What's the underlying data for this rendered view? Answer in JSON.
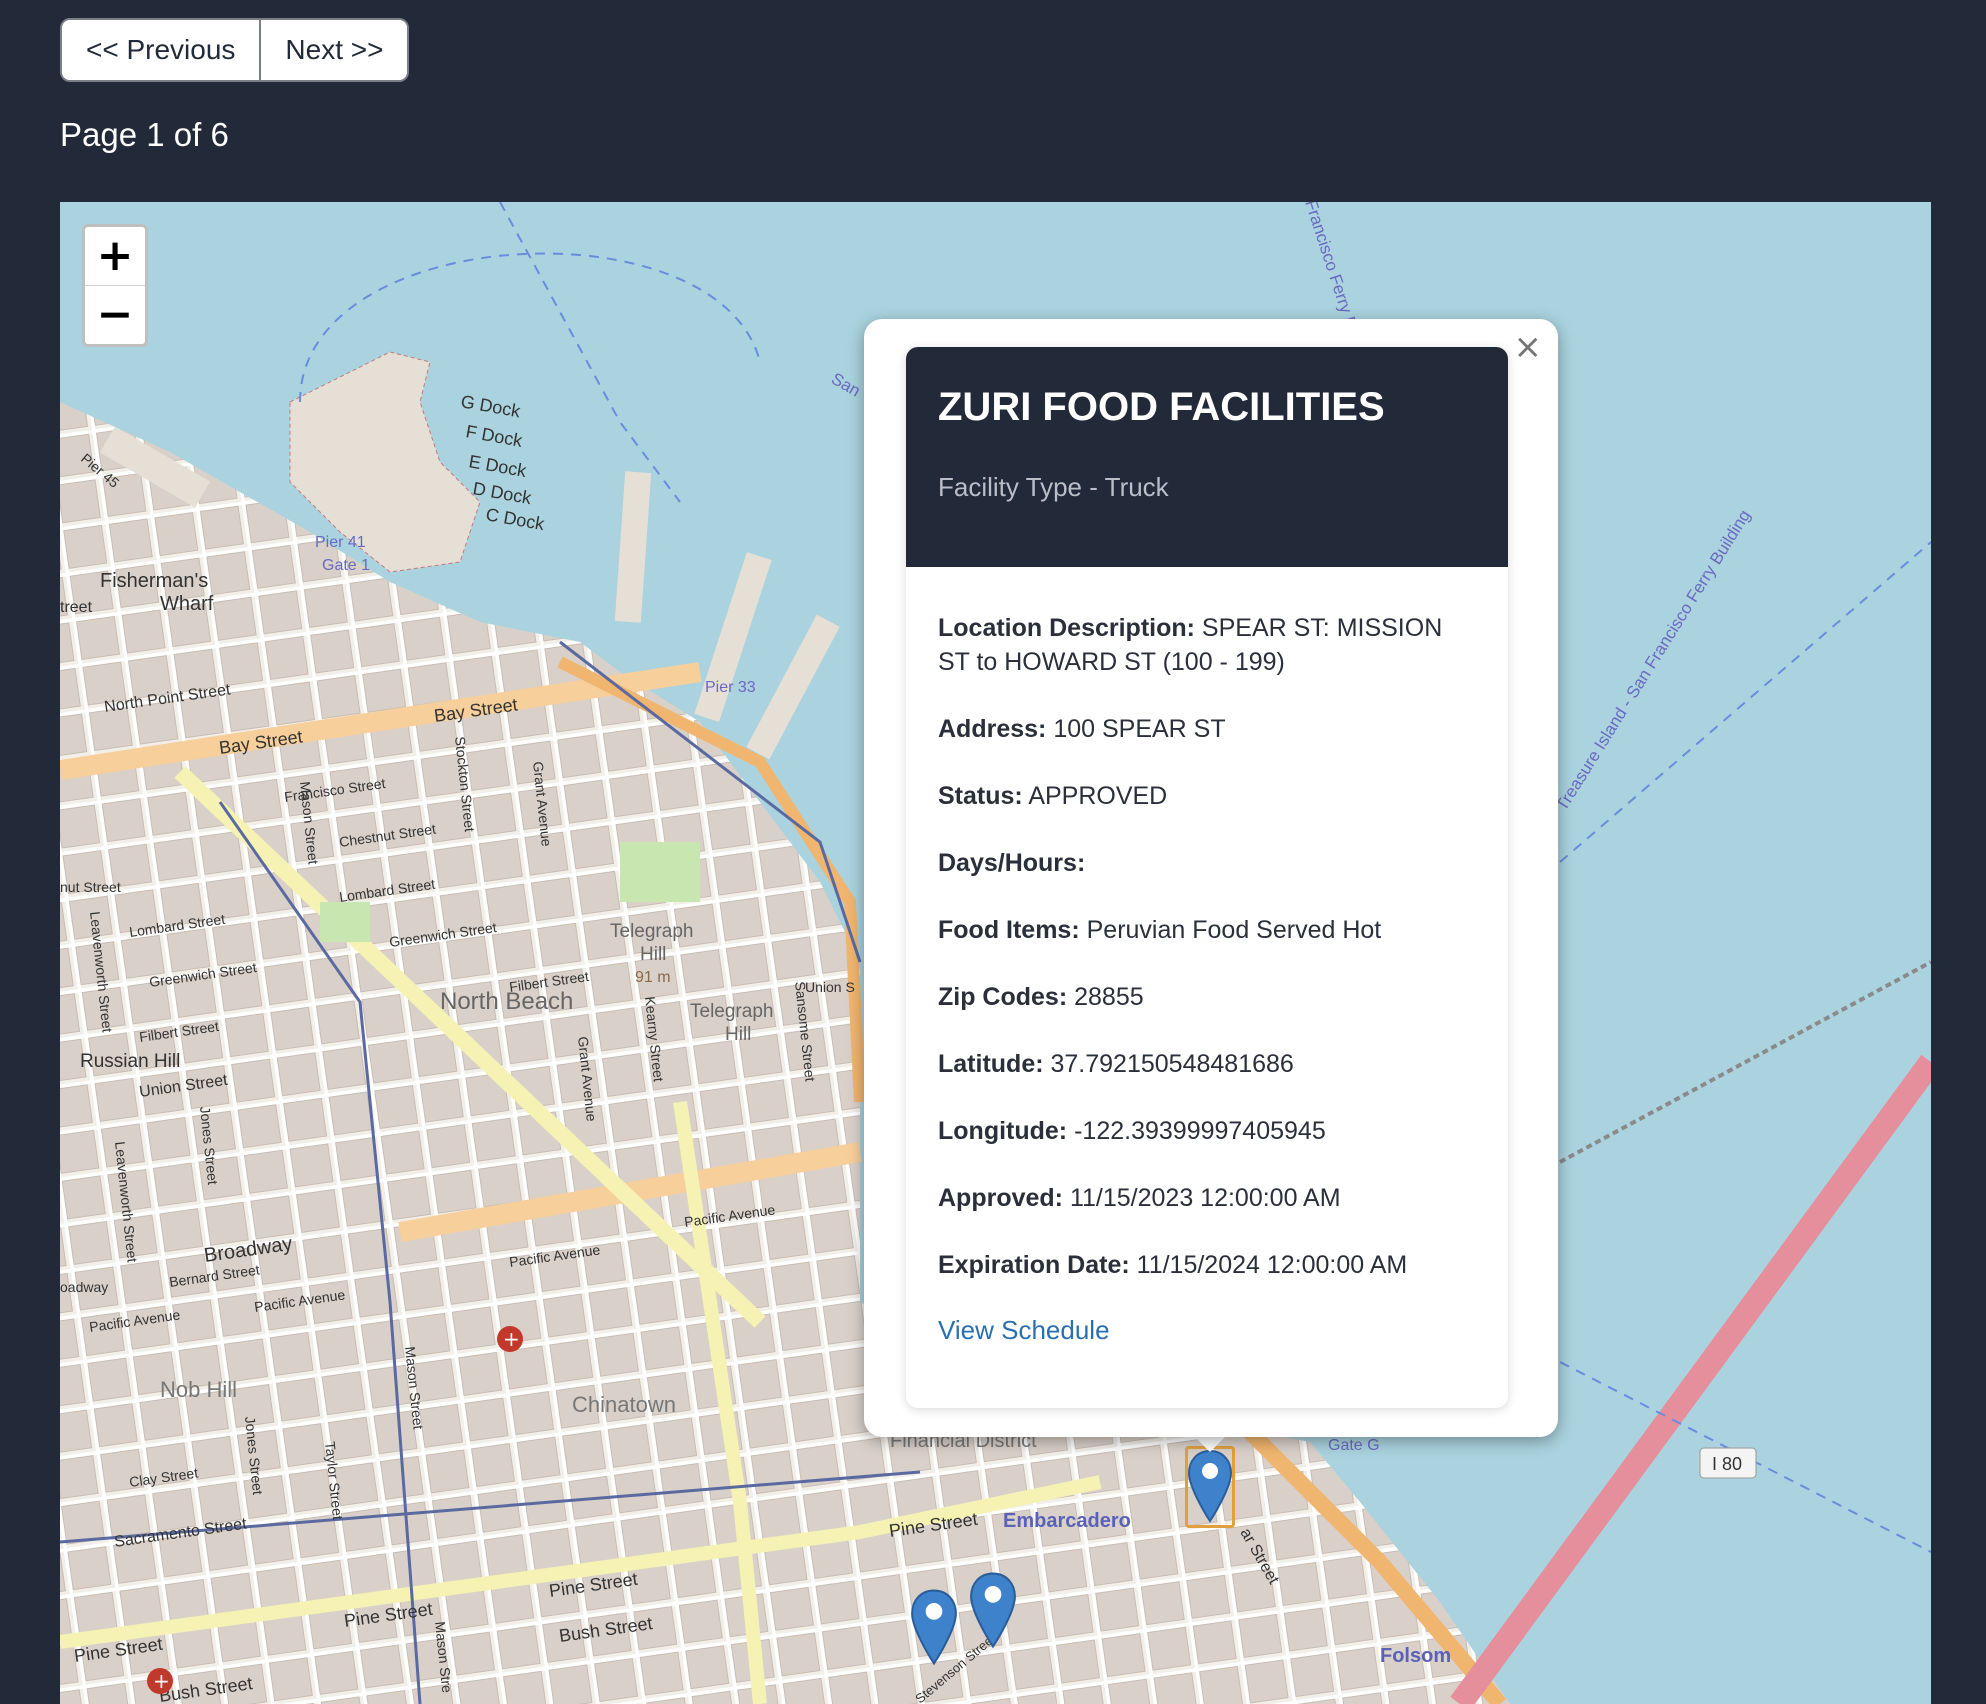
{
  "pager": {
    "prev_label": "<< Previous",
    "next_label": "Next >>",
    "page_text": "Page 1 of 6"
  },
  "map": {
    "zoom_in": "+",
    "zoom_out": "−",
    "labels": {
      "g_dock": "G Dock",
      "f_dock": "F Dock",
      "e_dock": "E Dock",
      "d_dock": "D Dock",
      "c_dock": "C Dock",
      "pier45": "Pier 45",
      "pier41": "Pier 41",
      "gate1": "Gate 1",
      "pier33": "Pier 33",
      "fishermans": "Fisherman's",
      "wharf": "Wharf",
      "north_point": "North Point Street",
      "bay1": "Bay Street",
      "bay2": "Bay Street",
      "francisco": "Francisco Street",
      "chestnut": "Chestnut Street",
      "lombard1": "Lombard Street",
      "lombard2": "Lombard Street",
      "greenwich1": "Greenwich Street",
      "greenwich2": "Greenwich Street",
      "filbert1": "Filbert Street",
      "filbert2": "Filbert Street",
      "union": "Union Street",
      "russian_hill": "Russian Hill",
      "north_beach": "North Beach",
      "telegraph": "Telegraph",
      "hill": "Hill",
      "hill_alt": "91 m",
      "telegraph2": "Telegraph",
      "hill2": "Hill",
      "broadway": "Broadway",
      "bernard": "Bernard Street",
      "pacific1": "Pacific Avenue",
      "pacific2": "Pacific Avenue",
      "pacific3": "Pacific Avenue",
      "pacific4": "Pacific Avenue",
      "nob_hill": "Nob Hill",
      "chinatown": "Chinatown",
      "clay": "Clay Street",
      "sacramento": "Sacramento Street",
      "pine1": "Pine Street",
      "pine2": "Pine Street",
      "pine3": "Pine Street",
      "pine4": "Pine Street",
      "bush1": "Bush Street",
      "bush2": "Bush Street",
      "financial": "Financial District",
      "embarcadero": "Embarcadero",
      "folsom": "Folsom",
      "gate_g": "Gate G",
      "i80": "I 80",
      "treasure": "Treasure Island - San Francisco Ferry Building",
      "ferry": "Francisco Ferry B",
      "san": "San",
      "sansome": "Sansome Street",
      "kearny": "Kearny Street",
      "grant1": "Grant Avenue",
      "grant2": "Grant Avenue",
      "stockton": "Stockton Street",
      "mason1": "Mason Street",
      "mason2": "Mason Street",
      "mason3": "Mason Stre",
      "jones1": "Jones Street",
      "jones2": "Jones Street",
      "taylor": "Taylor Street",
      "leavenworth1": "Leavenworth Street",
      "leavenworth2": "Leavenworth Street",
      "union_s": "Union S",
      "street_w": "treet",
      "nut": "nut Street",
      "oadway": "oadway",
      "stevenson": "Stevenson Stree",
      "spear": "ar Street"
    }
  },
  "popup": {
    "close": "×",
    "title": "ZURI FOOD FACILITIES",
    "subtitle": "Facility Type - Truck",
    "fields": [
      {
        "label": "Location Description:",
        "value": "SPEAR ST: MISSION ST to HOWARD ST (100 - 199)"
      },
      {
        "label": "Address:",
        "value": "100 SPEAR ST"
      },
      {
        "label": "Status:",
        "value": "APPROVED"
      },
      {
        "label": "Days/Hours:",
        "value": ""
      },
      {
        "label": "Food Items:",
        "value": "Peruvian Food Served Hot"
      },
      {
        "label": "Zip Codes:",
        "value": "28855"
      },
      {
        "label": "Latitude:",
        "value": "37.792150548481686"
      },
      {
        "label": "Longitude:",
        "value": "-122.39399997405945"
      },
      {
        "label": "Approved:",
        "value": "11/15/2023 12:00:00 AM"
      },
      {
        "label": "Expiration Date:",
        "value": "11/15/2024 12:00:00 AM"
      }
    ],
    "link": "View Schedule"
  }
}
